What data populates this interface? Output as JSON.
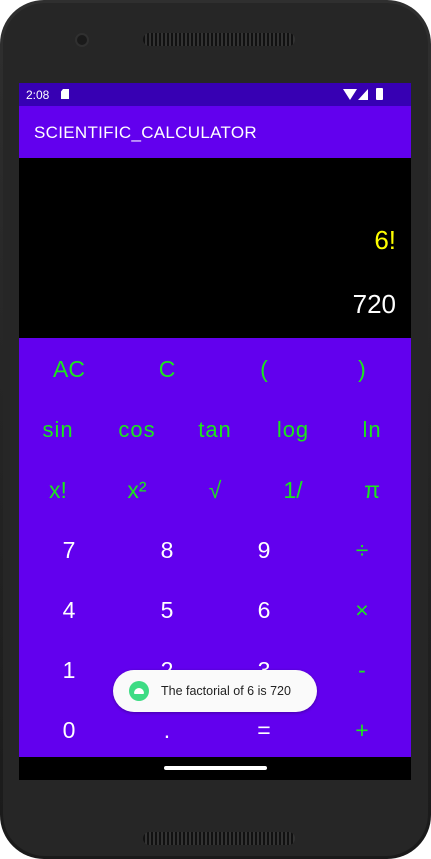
{
  "status": {
    "time": "2:08"
  },
  "app": {
    "title": "SCIENTIFIC_CALCULATOR"
  },
  "display": {
    "expression": "6!",
    "result": "720"
  },
  "keypad": {
    "rows": [
      [
        "AC",
        "C",
        "(",
        ")"
      ],
      [
        "sin",
        "cos",
        "tan",
        "log",
        "ln"
      ],
      [
        "x!",
        "x²",
        "√",
        "1/",
        "π"
      ],
      [
        "7",
        "8",
        "9",
        "÷"
      ],
      [
        "4",
        "5",
        "6",
        "×"
      ],
      [
        "1",
        "2",
        "3",
        "-"
      ],
      [
        "0",
        ".",
        "=",
        "+"
      ]
    ]
  },
  "toast": {
    "text": "The factorial of 6 is 720"
  },
  "colors": {
    "status_bar": "#3700b3",
    "app_bar": "#6200ee",
    "keypad": "#6200ee",
    "accent_green": "#1ce61c",
    "expression": "#ffff00"
  }
}
